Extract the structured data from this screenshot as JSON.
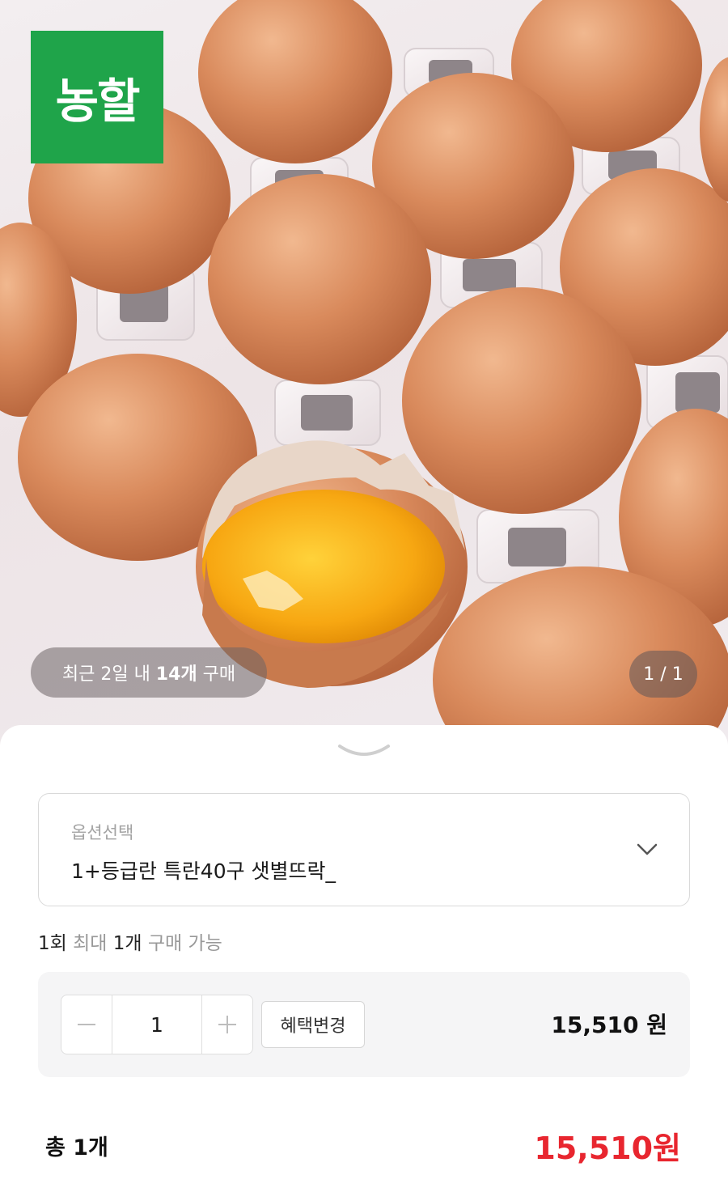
{
  "hero": {
    "image_description": "",
    "brand_badge": "농할",
    "recent_purchase": {
      "prefix": "최근 2일 내 ",
      "count": "14개",
      "suffix": " 구매"
    },
    "image_counter": "1 / 1"
  },
  "sheet": {
    "option": {
      "label": "옵션선택",
      "value": "1+등급란 특란40구 샛별뜨락_"
    },
    "limit": {
      "a": "1회",
      "b": " 최대 ",
      "c": "1개",
      "d": " 구매 가능"
    },
    "quantity": {
      "value": "1",
      "benefit_button": "혜택변경",
      "price": "15,510",
      "unit": "원"
    },
    "total": {
      "label": "총 1개",
      "price": "15,510",
      "unit": "원"
    }
  },
  "colors": {
    "brand_green": "#1fa44a",
    "total_red": "#e8262f",
    "panel_bg": "#f5f5f6"
  },
  "icons": [
    "minus-icon",
    "plus-icon",
    "chevron-down-icon",
    "sheet-handle-icon"
  ]
}
